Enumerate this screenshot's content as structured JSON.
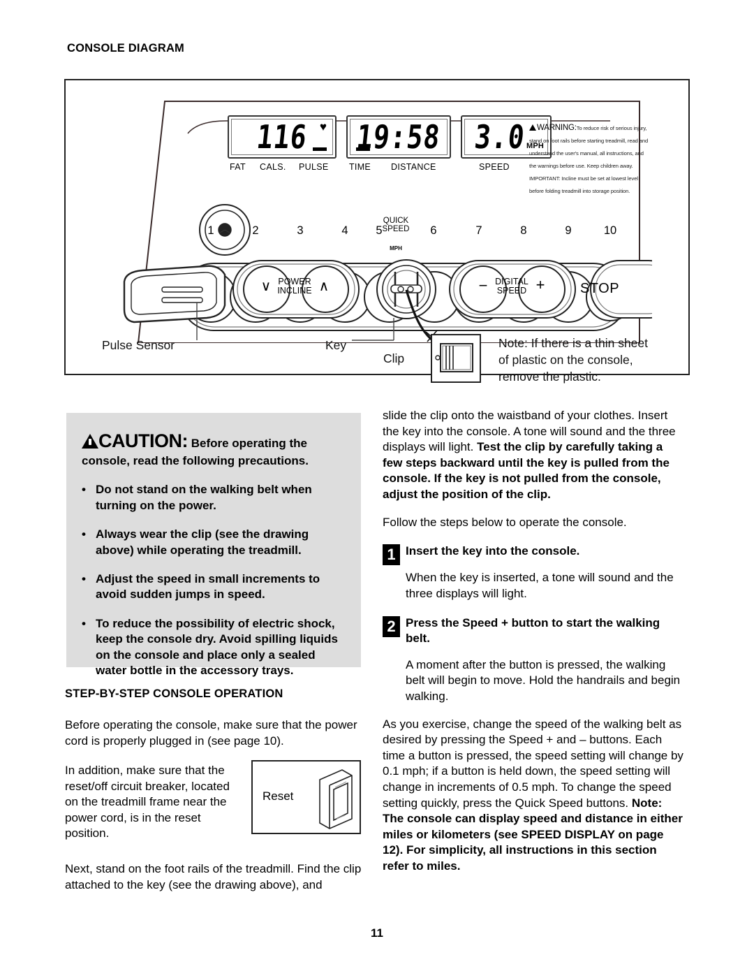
{
  "page": {
    "number": "11"
  },
  "sections": {
    "console_diagram_heading": "CONSOLE DIAGRAM",
    "step_by_step_heading": "STEP-BY-STEP CONSOLE OPERATION"
  },
  "diagram": {
    "displays": [
      {
        "value": "116",
        "icon": "heart-icon",
        "captions": [
          "FAT",
          "CALS.",
          "PULSE"
        ]
      },
      {
        "value": "19:58",
        "captions": [
          "TIME",
          "DISTANCE"
        ]
      },
      {
        "value": "3.0",
        "unit": "MPH",
        "captions": [
          "SPEED"
        ]
      }
    ],
    "warning": {
      "title": "WARNING:",
      "text": "To reduce risk of serious injury, stand on foot rails before starting treadmill, read and understand the user's manual, all instructions, and the warnings before use. Keep children away.  IMPORTANT: Incline must be set at lowest level before folding treadmill into storage position."
    },
    "quick_speed": {
      "label_line1": "QUICK",
      "label_line2": "SPEED",
      "unit": "MPH",
      "buttons": [
        "1",
        "2",
        "3",
        "4",
        "5",
        "6",
        "7",
        "8",
        "9",
        "10"
      ]
    },
    "buttons": {
      "incline": {
        "line1": "POWER",
        "line2": "INCLINE",
        "down": "∨",
        "up": "∧"
      },
      "digital_speed": {
        "line1": "DIGITAL",
        "line2": "SPEED",
        "minus": "−",
        "plus": "+"
      },
      "stop": "STOP"
    },
    "callouts": {
      "pulse_sensor": "Pulse Sensor",
      "key": "Key",
      "clip": "Clip",
      "note_line1": "Note: If there is a thin sheet",
      "note_line2": "of plastic on the console,",
      "note_line3": "remove the plastic."
    }
  },
  "caution": {
    "symbol_label": "caution-triangle",
    "word": "CAUTION:",
    "heading_rest": "Before operating the console, read the following precautions.",
    "bullets": [
      "Do not stand on the walking belt when turning on the power.",
      "Always wear the clip (see the drawing above) while operating the treadmill.",
      "Adjust the speed in small increments to avoid sudden jumps in speed.",
      "To reduce the possibility of electric shock, keep the console dry. Avoid spilling liquids on the console and place only a sealed water bottle in the accessory trays."
    ]
  },
  "left_column": {
    "p1": "Before operating the console, make sure that the power cord is properly plugged in (see page 10).",
    "p2": "In addition, make sure that the reset/off circuit breaker, located on the treadmill frame near the power cord, is in the reset position.",
    "p3": "Next, stand on the foot rails of the treadmill. Find the clip attached to the key (see the drawing above), and",
    "reset_figure_label": "Reset"
  },
  "right_column": {
    "intro_plain": "slide the clip onto the waistband of your clothes. Insert the key into the console. A tone will sound and the three displays will light.",
    "intro_bold": "Test the clip by carefully taking a few steps backward until the key is pulled from the console. If the key is not pulled from the console, adjust the position of the clip.",
    "follow": "Follow the steps below to operate the console.",
    "steps": [
      {
        "number": "1",
        "title": "Insert the key into the console.",
        "body": "When the key is inserted, a tone will sound and the three displays will light."
      },
      {
        "number": "2",
        "title": "Press the Speed + button to start the walking belt.",
        "body": "A moment after the button is pressed, the walking belt will begin to move. Hold the handrails and begin walking."
      }
    ],
    "p_speed_plain": "As you exercise, change the speed of the walking belt as desired by pressing the Speed + and – buttons. Each time a button is pressed, the speed setting will change by 0.1 mph; if a button is held down, the speed setting will change in increments of 0.5 mph. To change the speed setting quickly, press the Quick Speed buttons.",
    "p_speed_bold": "Note: The console can display speed and distance in either miles or kilometers (see SPEED DISPLAY on page 12). For simplicity, all instructions in this section refer to miles."
  }
}
